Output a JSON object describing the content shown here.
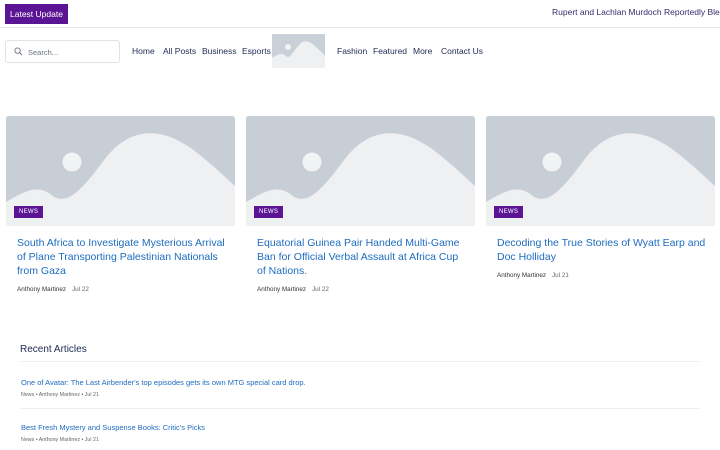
{
  "ticker": {
    "badge": "Latest  Update",
    "headline": "Rupert and Lachlan Murdoch Reportedly Blesse"
  },
  "search": {
    "placeholder": "Search..."
  },
  "nav": {
    "items": [
      "Home",
      "All Posts",
      "Business",
      "Esports",
      "Fashion",
      "Featured",
      "More",
      "Contact Us"
    ]
  },
  "cards": [
    {
      "badge": "NEWS",
      "title": "South Africa to Investigate Mysterious Arrival of Plane Transporting Palestinian Nationals from Gaza",
      "author": "Anthony Martinez",
      "date": "Jul 22"
    },
    {
      "badge": "NEWS",
      "title": "Equatorial Guinea Pair Handed Multi-Game Ban for Official Verbal Assault at Africa Cup of Nations.",
      "author": "Anthony Martinez",
      "date": "Jul 22"
    },
    {
      "badge": "NEWS",
      "title": "Decoding the True Stories of Wyatt Earp and Doc Holliday",
      "author": "Anthony Martinez",
      "date": "Jul 21"
    }
  ],
  "recent": {
    "heading": "Recent Articles",
    "items": [
      {
        "title": "One of Avatar: The Last Airbender's top episodes gets its own MTG special card drop.",
        "meta": "News • Anthony Martinez • Jul 21"
      },
      {
        "title": "Best Fresh Mystery and Suspense Books: Critic's Picks",
        "meta": "News • Anthony Martinez • Jul 21"
      }
    ]
  },
  "colors": {
    "accent": "#5b1494",
    "link": "#1d6cc0",
    "nav_text": "#1e2a55",
    "placeholder_bg": "#c7ced6"
  },
  "icons": {
    "search": "search-icon",
    "image_placeholder": "image-placeholder-icon"
  }
}
